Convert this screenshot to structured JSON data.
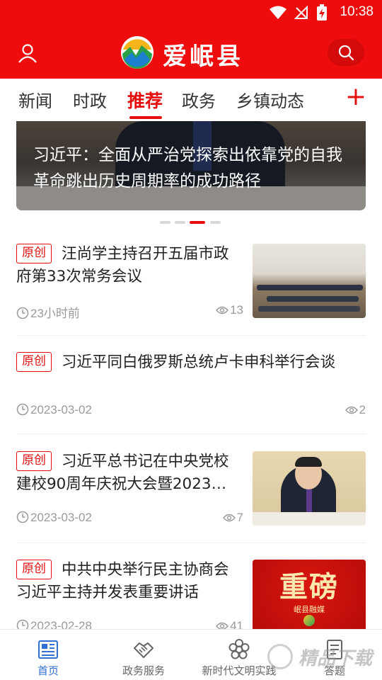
{
  "status_bar": {
    "time": "10:38"
  },
  "header": {
    "title": "爱岷县",
    "colors": {
      "brand": "#ee0c0c"
    },
    "icons": {
      "user": "user-icon",
      "search": "search-icon"
    }
  },
  "tabs": {
    "items": [
      {
        "label": "新闻"
      },
      {
        "label": "时政"
      },
      {
        "label": "推荐",
        "active": true
      },
      {
        "label": "政务"
      },
      {
        "label": "乡镇动态"
      }
    ],
    "add_label": "+"
  },
  "banner": {
    "title": "习近平：全面从严治党探索出依靠党的自我革命跳出历史周期率的成功路径",
    "pager": {
      "count": 4,
      "active_index": 2
    }
  },
  "feed": [
    {
      "badge": "原创",
      "title": "汪尚学主持召开五届市政府第33次常务会议",
      "time": "23小时前",
      "views": "13"
    },
    {
      "badge": "原创",
      "title": "习近平同白俄罗斯总统卢卡申科举行会谈",
      "time": "2023-03-02",
      "views": "2"
    },
    {
      "badge": "原创",
      "title": "习近平总书记在中央党校建校90周年庆祝大会暨2023…",
      "time": "2023-03-02",
      "views": "7"
    },
    {
      "badge": "原创",
      "title": "中共中央举行民主协商会习近平主持并发表重要讲话",
      "time": "2023-02-28",
      "views": "41",
      "thumb_text": "重磅",
      "thumb_sub": "岷县融媒"
    }
  ],
  "bottom_nav": [
    {
      "label": "首页",
      "icon": "home-news-icon",
      "active": true
    },
    {
      "label": "政务服务",
      "icon": "handshake-icon"
    },
    {
      "label": "新时代文明实践",
      "icon": "flower-icon"
    },
    {
      "label": "答题",
      "icon": "quiz-icon"
    }
  ],
  "watermark": "精品下载"
}
